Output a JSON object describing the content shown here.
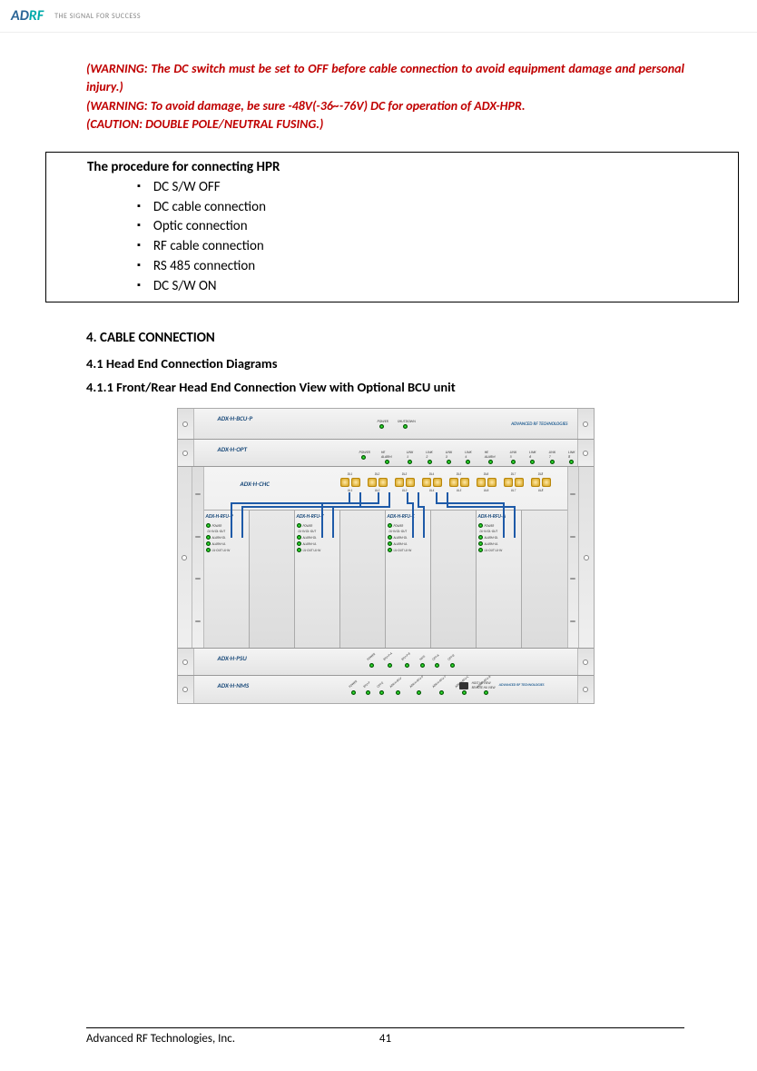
{
  "header": {
    "logo_a": "AD",
    "logo_b": "RF",
    "tagline": "THE SIGNAL FOR SUCCESS"
  },
  "warnings": {
    "w1": "(WARNING: The DC switch must be set to OFF before cable connection to avoid equipment damage and personal injury.)",
    "w2": "(WARNING: To avoid damage, be sure -48V(-36~-76V) DC for operation of ADX-HPR.",
    "w3": "(CAUTION: DOUBLE POLE/NEUTRAL FUSING.)"
  },
  "procedure": {
    "title": "The procedure for connecting HPR",
    "items": [
      "DC  S/W OFF",
      "DC cable connection",
      "Optic connection",
      "RF cable connection",
      "RS 485 connection",
      "DC  S/W ON"
    ]
  },
  "sections": {
    "s4": "4.    CABLE CONNECTION",
    "s41": "4.1   Head End Connection Diagrams",
    "s411": "4.1.1      Front/Rear Head End Connection View with Optional BCU unit"
  },
  "diagram": {
    "modules": {
      "bcu": "ADX-H-BCU-P",
      "opt": "ADX-H-OPT",
      "chc": "ADX-H-CHC",
      "rfu": [
        "ADX-H-RFU-P",
        "ADX-H-RFU-7",
        "ADX-H-RFU-C",
        "ADX-H-RFU-A"
      ],
      "psu": "ADX-H-PSU",
      "nms": "ADX-H-NMS"
    },
    "bcu_leds": [
      "POWER",
      "SHUTDOWN"
    ],
    "opt_leds": [
      "POWER",
      "HE ALARM",
      "LINK 1",
      "LINK 2",
      "LINK 3",
      "LINK 4",
      "HE ALARM",
      "LINK 5",
      "LINK 6",
      "LINK 7",
      "LINK 8"
    ],
    "chc_ports": [
      "DL1",
      "UL1",
      "DL2",
      "UL2",
      "DL3",
      "UL3",
      "DL4",
      "UL4",
      "DL5",
      "UL5",
      "DL6",
      "UL6",
      "DL7",
      "UL7",
      "DL8",
      "UL8"
    ],
    "rfu_rows": [
      "POWER",
      "ALARM-DL",
      "DL-IN   DL-OUT",
      "ALARM-UL",
      "UL-OUT  UL-IN"
    ],
    "psu_leds": [
      "POWER",
      "RFU-P-A",
      "RFU-P-B",
      "NMS",
      "OPT-A",
      "OPT-B"
    ],
    "nms_leds": [
      "POWER",
      "RFU-P",
      "OPT-E",
      "ADX-H-BCU",
      "ADX-H-RFU-P",
      "ADX-H-RFU-7",
      "ADX-H-RFU-C",
      "ADX-H-RFU-A"
    ],
    "nms_right": {
      "host": "HOST",
      "heview": "HE VIEW",
      "remote": "REMOTE HU VIEW"
    },
    "brand": "ADVANCED RF TECHNOLOGIES"
  },
  "footer": {
    "company": "Advanced RF Technologies, Inc.",
    "page": "41"
  }
}
